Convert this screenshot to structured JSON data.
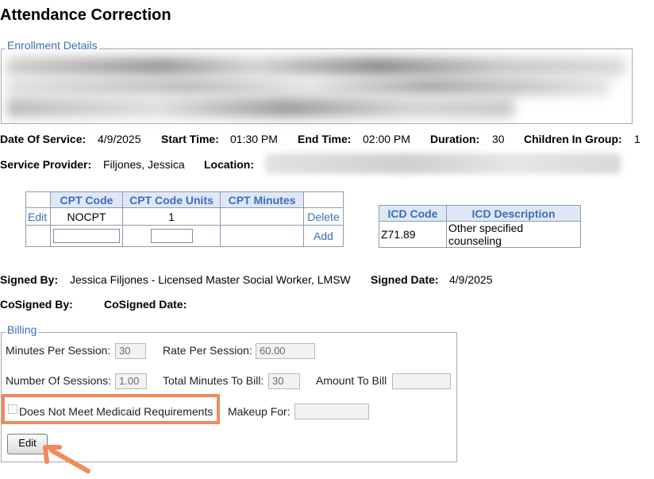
{
  "page": {
    "title": "Attendance Correction"
  },
  "enrollment": {
    "legend": "Enrollment Details"
  },
  "service": {
    "date_label": "Date Of Service:",
    "date": "4/9/2025",
    "start_label": "Start Time:",
    "start": "01:30 PM",
    "end_label": "End Time:",
    "end": "02:00 PM",
    "duration_label": "Duration:",
    "duration": "30",
    "children_label": "Children In Group:",
    "children": "1",
    "provider_label": "Service Provider:",
    "provider": "Filjones, Jessica",
    "location_label": "Location:"
  },
  "cpt": {
    "headers": [
      "CPT Code",
      "CPT Code Units",
      "CPT Minutes"
    ],
    "row": {
      "edit": "Edit",
      "code": "NOCPT",
      "units": "1",
      "minutes": "",
      "delete": "Delete"
    },
    "add": "Add"
  },
  "icd": {
    "headers": [
      "ICD Code",
      "ICD Description"
    ],
    "row": {
      "code": "Z71.89",
      "description": "Other specified counseling"
    }
  },
  "signature": {
    "signed_by_label": "Signed By:",
    "signed_by": "Jessica Filjones - Licensed Master Social Worker, LMSW",
    "signed_date_label": "Signed Date:",
    "signed_date": "4/9/2025",
    "cosigned_by_label": "CoSigned By:",
    "cosigned_date_label": "CoSigned Date:"
  },
  "billing": {
    "legend": "Billing",
    "minutes_label": "Minutes Per Session:",
    "minutes": "30",
    "rate_label": "Rate Per Session:",
    "rate": "60.00",
    "sessions_label": "Number Of Sessions:",
    "sessions": "1.00",
    "total_label": "Total Minutes To Bill:",
    "total": "30",
    "amount_label": "Amount To Bill",
    "amount": "",
    "medicaid_label": "Does Not Meet Medicaid Requirements",
    "makeup_label": "Makeup For:",
    "makeup": "",
    "edit_button": "Edit"
  },
  "colors": {
    "highlight": "#f08a5d",
    "link": "#3b6fb6",
    "header_bg": "#dfe7f6"
  }
}
